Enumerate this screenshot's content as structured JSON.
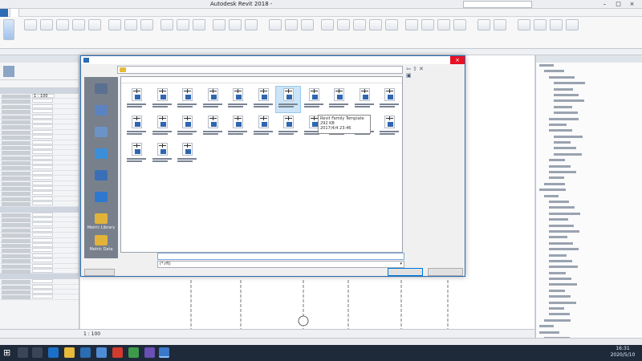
{
  "window": {
    "app_title": "Autodesk Revit 2018 -",
    "doc_title": "",
    "search_placeholder": ""
  },
  "ribbon": {
    "tabs": [
      "",
      "",
      "",
      "",
      "",
      "",
      "",
      "",
      "",
      "",
      "",
      "",
      ""
    ]
  },
  "dialog": {
    "title": "",
    "current_folder": "",
    "view_menu": "",
    "preview_label": "",
    "column_headers": [
      "",
      "",
      "",
      ""
    ],
    "file_count": 25,
    "selected_index": 6,
    "tooltip": {
      "line1": "",
      "line2": "Revit Family Template",
      "line3": "292 KB",
      "line4": "2017/4/4 23:46"
    },
    "filename_label": "",
    "filename_value": "",
    "filetype_label": "",
    "filetype_value": "(*.rft)",
    "tools_label": "",
    "open_label": "",
    "cancel_label": "",
    "places": [
      {
        "label": "",
        "icon": "history-icon",
        "color": "#5b6f91"
      },
      {
        "label": "",
        "icon": "documents-icon",
        "color": "#5b83c2"
      },
      {
        "label": "",
        "icon": "my-computer-icon",
        "color": "#6b93c8"
      },
      {
        "label": "",
        "icon": "network-icon",
        "color": "#3b8fd8"
      },
      {
        "label": "",
        "icon": "favorites-icon",
        "color": "#3a6fb8"
      },
      {
        "label": "",
        "icon": "desktop-icon",
        "color": "#2f78d0"
      },
      {
        "label": "Metric Library",
        "icon": "metric-library-icon",
        "color": "#e2b33a"
      },
      {
        "label": "Metric Data",
        "icon": "metric-data-icon",
        "color": "#e2b33a"
      }
    ]
  },
  "properties": {
    "title": "",
    "scale_value": "1 : 100"
  },
  "project_browser": {
    "title": ""
  },
  "statusbar": {
    "scale": "1 : 100"
  },
  "clock": {
    "time": "16:31",
    "date": "2020/5/10"
  },
  "subtitle": "",
  "colors": {
    "accent": "#2b6cb3",
    "taskbar": "#1e2a3a",
    "close": "#e81123"
  }
}
